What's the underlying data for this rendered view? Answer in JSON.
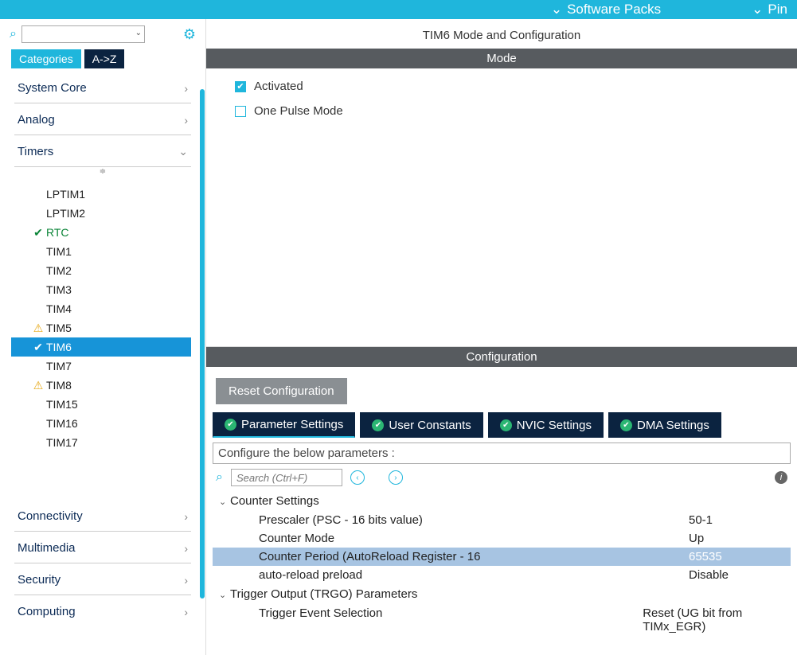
{
  "topbar": {
    "packs_label": "Software Packs",
    "pin_label": "Pin"
  },
  "sidebar": {
    "search_placeholder": "",
    "tabs": {
      "categories": "Categories",
      "az": "A->Z"
    },
    "sections": {
      "system_core": "System Core",
      "analog": "Analog",
      "timers": "Timers",
      "connectivity": "Connectivity",
      "multimedia": "Multimedia",
      "security": "Security",
      "computing": "Computing"
    },
    "timers": [
      {
        "label": "LPTIM1",
        "icon": ""
      },
      {
        "label": "LPTIM2",
        "icon": ""
      },
      {
        "label": "RTC",
        "icon": "check",
        "color": "green"
      },
      {
        "label": "TIM1",
        "icon": ""
      },
      {
        "label": "TIM2",
        "icon": ""
      },
      {
        "label": "TIM3",
        "icon": ""
      },
      {
        "label": "TIM4",
        "icon": ""
      },
      {
        "label": "TIM5",
        "icon": "warn"
      },
      {
        "label": "TIM6",
        "icon": "okcircle",
        "selected": true
      },
      {
        "label": "TIM7",
        "icon": ""
      },
      {
        "label": "TIM8",
        "icon": "warn"
      },
      {
        "label": "TIM15",
        "icon": ""
      },
      {
        "label": "TIM16",
        "icon": ""
      },
      {
        "label": "TIM17",
        "icon": ""
      }
    ]
  },
  "main": {
    "title": "TIM6 Mode and Configuration",
    "mode_header": "Mode",
    "activated_label": "Activated",
    "one_pulse_label": "One Pulse Mode",
    "config_header": "Configuration",
    "reset_label": "Reset Configuration",
    "tabs": {
      "param": "Parameter Settings",
      "user": "User Constants",
      "nvic": "NVIC Settings",
      "dma": "DMA Settings"
    },
    "configure_line": "Configure the below parameters :",
    "search_placeholder": "Search (Ctrl+F)",
    "groups": {
      "counter": "Counter Settings",
      "trgo": "Trigger Output (TRGO) Parameters"
    },
    "params": {
      "prescaler_label": "Prescaler (PSC - 16 bits value)",
      "prescaler_value": "50-1",
      "counter_mode_label": "Counter Mode",
      "counter_mode_value": "Up",
      "counter_period_label": "Counter Period (AutoReload Register - 16",
      "counter_period_value": "65535",
      "auto_reload_label": "auto-reload preload",
      "auto_reload_value": "Disable",
      "trigger_label": "Trigger Event Selection",
      "trigger_value": "Reset (UG bit from TIMx_EGR)"
    }
  }
}
